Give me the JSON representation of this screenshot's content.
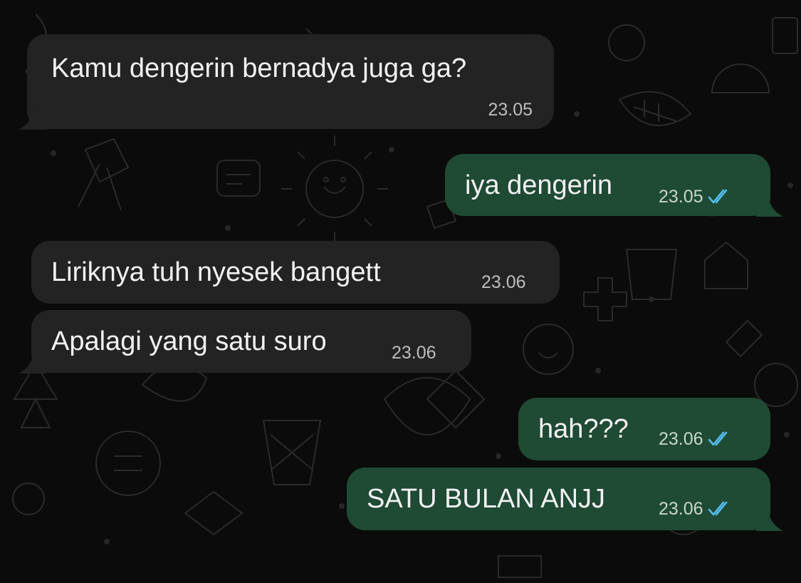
{
  "colors": {
    "background": "#0b0b0b",
    "incoming_bubble": "#232323",
    "outgoing_bubble": "#1f4a34",
    "read_ticks": "#53bdeb"
  },
  "messages": [
    {
      "direction": "incoming",
      "text": "Kamu dengerin bernadya juga ga?",
      "time": "23.05"
    },
    {
      "direction": "outgoing",
      "text": "iya dengerin",
      "time": "23.05",
      "status_icon": "double-check-read-icon"
    },
    {
      "direction": "incoming",
      "text": "Liriknya tuh nyesek bangett",
      "time": "23.06"
    },
    {
      "direction": "incoming",
      "text": "Apalagi yang satu suro",
      "time": "23.06"
    },
    {
      "direction": "outgoing",
      "text": "hah???",
      "time": "23.06",
      "status_icon": "double-check-read-icon"
    },
    {
      "direction": "outgoing",
      "text": "SATU BULAN ANJJ",
      "time": "23.06",
      "status_icon": "double-check-read-icon"
    }
  ]
}
